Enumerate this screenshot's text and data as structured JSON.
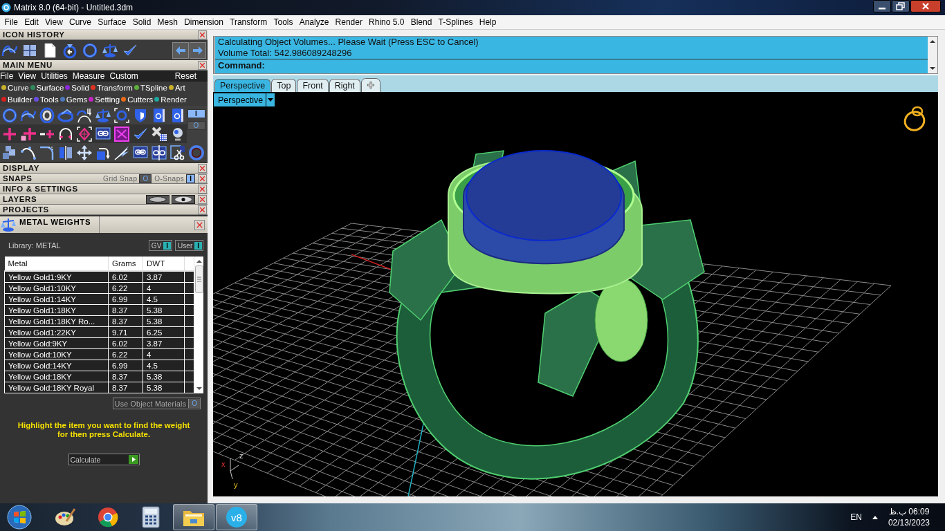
{
  "window": {
    "title": "Matrix 8.0 (64-bit) - Untitled.3dm"
  },
  "menu_bar": [
    "File",
    "Edit",
    "View",
    "Curve",
    "Surface",
    "Solid",
    "Mesh",
    "Dimension",
    "Transform",
    "Tools",
    "Analyze",
    "Render",
    "Rhino 5.0",
    "Blend",
    "T-Splines",
    "Help"
  ],
  "icon_history": {
    "title": "ICON HISTORY"
  },
  "main_menu": {
    "title": "MAIN MENU",
    "menu": [
      "File",
      "View",
      "Utilities",
      "Measure",
      "Custom"
    ],
    "reset": "Reset",
    "categories": [
      {
        "label": "Curve",
        "color": "#c9b02c"
      },
      {
        "label": "Surface",
        "color": "#2f8a5c"
      },
      {
        "label": "Solid",
        "color": "#8a2ad8"
      },
      {
        "label": "Transform",
        "color": "#e0321e"
      },
      {
        "label": "TSpline",
        "color": "#5fae3c"
      },
      {
        "label": "Art",
        "color": "#c9b02c"
      },
      {
        "label": "Builder",
        "color": "#d8201e"
      },
      {
        "label": "Tools",
        "color": "#6a4ee0"
      },
      {
        "label": "Gems",
        "color": "#4a78b8"
      },
      {
        "label": "Setting",
        "color": "#c424c4"
      },
      {
        "label": "Cutters",
        "color": "#e86a18"
      },
      {
        "label": "Render",
        "color": "#1ea8a0"
      }
    ],
    "toggles": [
      {
        "label": "I",
        "on": true
      },
      {
        "label": "O",
        "on": false
      }
    ]
  },
  "sections": [
    {
      "title": "DISPLAY",
      "kind": "plain"
    },
    {
      "title": "SNAPS",
      "kind": "snaps",
      "items": [
        {
          "label": "Grid Snap",
          "toggle": "O",
          "on": false
        },
        {
          "label": "O-Snaps",
          "toggle": "I",
          "on": true
        }
      ]
    },
    {
      "title": "INFO & SETTINGS",
      "kind": "plain"
    },
    {
      "title": "LAYERS",
      "kind": "layers"
    },
    {
      "title": "PROJECTS",
      "kind": "plain"
    }
  ],
  "metal_weights": {
    "title": "METAL WEIGHTS",
    "library": "Library: METAL",
    "filters": [
      {
        "label": "GV",
        "toggle": "I",
        "on": true
      },
      {
        "label": "User",
        "toggle": "I",
        "on": true
      }
    ],
    "table": {
      "columns": [
        "Metal",
        "Grams",
        "DWT"
      ],
      "rows": [
        [
          "Yellow Gold1:9KY",
          "6.02",
          "3.87"
        ],
        [
          "Yellow Gold1:10KY",
          "6.22",
          "4"
        ],
        [
          "Yellow Gold1:14KY",
          "6.99",
          "4.5"
        ],
        [
          "Yellow Gold1:18KY",
          "8.37",
          "5.38"
        ],
        [
          "Yellow Gold1:18KY Ro...",
          "8.37",
          "5.38"
        ],
        [
          "Yellow Gold1:22KY",
          "9.71",
          "6.25"
        ],
        [
          "Yellow Gold:9KY",
          "6.02",
          "3.87"
        ],
        [
          "Yellow Gold:10KY",
          "6.22",
          "4"
        ],
        [
          "Yellow Gold:14KY",
          "6.99",
          "4.5"
        ],
        [
          "Yellow Gold:18KY",
          "8.37",
          "5.38"
        ],
        [
          "Yellow Gold:18KY Royal",
          "8.37",
          "5.38"
        ]
      ]
    },
    "use_object_materials": {
      "label": "Use Object Materials",
      "toggle": "O",
      "on": false
    },
    "hint": "Highlight the item you want to find the weight for then press Calculate.",
    "calculate": "Calculate"
  },
  "command": {
    "lines": [
      "Calculating Object Volumes... Please Wait (Press ESC to Cancel)",
      "Volume Total: 542.986089248296"
    ],
    "prompt": "Command:"
  },
  "viewport": {
    "tabs": [
      {
        "label": "Perspective",
        "selected": true
      },
      {
        "label": "Top",
        "selected": false
      },
      {
        "label": "Front",
        "selected": false
      },
      {
        "label": "Right",
        "selected": false
      }
    ],
    "label": "Perspective",
    "axes": {
      "x": "x",
      "y": "y",
      "z": "z"
    }
  },
  "taskbar": {
    "apps": [
      {
        "kind": "paint",
        "open": false
      },
      {
        "kind": "chrome",
        "open": false
      },
      {
        "kind": "calculator",
        "open": false
      },
      {
        "kind": "explorer",
        "open": true
      },
      {
        "kind": "matrix",
        "label": "v8",
        "open": true
      }
    ],
    "language": "EN",
    "time": "06:09 ب.ظ",
    "date": "02/13/2023"
  }
}
